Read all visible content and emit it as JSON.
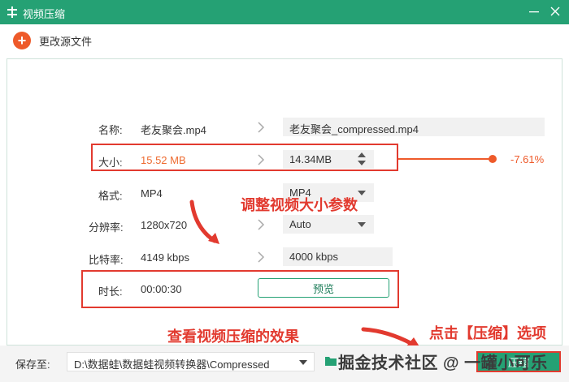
{
  "window": {
    "title": "视频压缩"
  },
  "toolbar": {
    "add_source_label": "更改源文件"
  },
  "rows": {
    "name": {
      "label": "名称:",
      "source": "老友聚会.mp4",
      "output": "老友聚会_compressed.mp4"
    },
    "size": {
      "label": "大小:",
      "source": "15.52 MB",
      "output": "14.34MB",
      "percent_text": "-7.61%",
      "slider_level": 0.96
    },
    "format": {
      "label": "格式:",
      "source": "MP4",
      "output": "MP4"
    },
    "resolution": {
      "label": "分辨率:",
      "source": "1280x720",
      "output": "Auto"
    },
    "bitrate": {
      "label": "比特率:",
      "source": "4149 kbps",
      "output": "4000 kbps"
    },
    "duration": {
      "label": "时长:",
      "source": "00:00:30",
      "preview_label": "预览"
    }
  },
  "annotations": {
    "adjust_size": "调整视频大小参数",
    "view_effect": "查看视频压缩的效果",
    "click_compress": "点击【压缩】选项"
  },
  "bottom": {
    "save_label": "保存至:",
    "save_path": "D:\\数据蛙\\数据蛙视频转换器\\Compressed",
    "watermark": "掘金技术社区 @ 一罐小可乐",
    "compress_label": "压缩"
  },
  "colors": {
    "titlebar": "#25a174",
    "accent_orange": "#ee5a2a",
    "highlight_red": "#e23a2f"
  },
  "icons": [
    "app-icon",
    "minimize-icon",
    "close-icon",
    "plus-circle-icon",
    "chevron-right-icon",
    "caret-down-icon",
    "folder-icon"
  ]
}
